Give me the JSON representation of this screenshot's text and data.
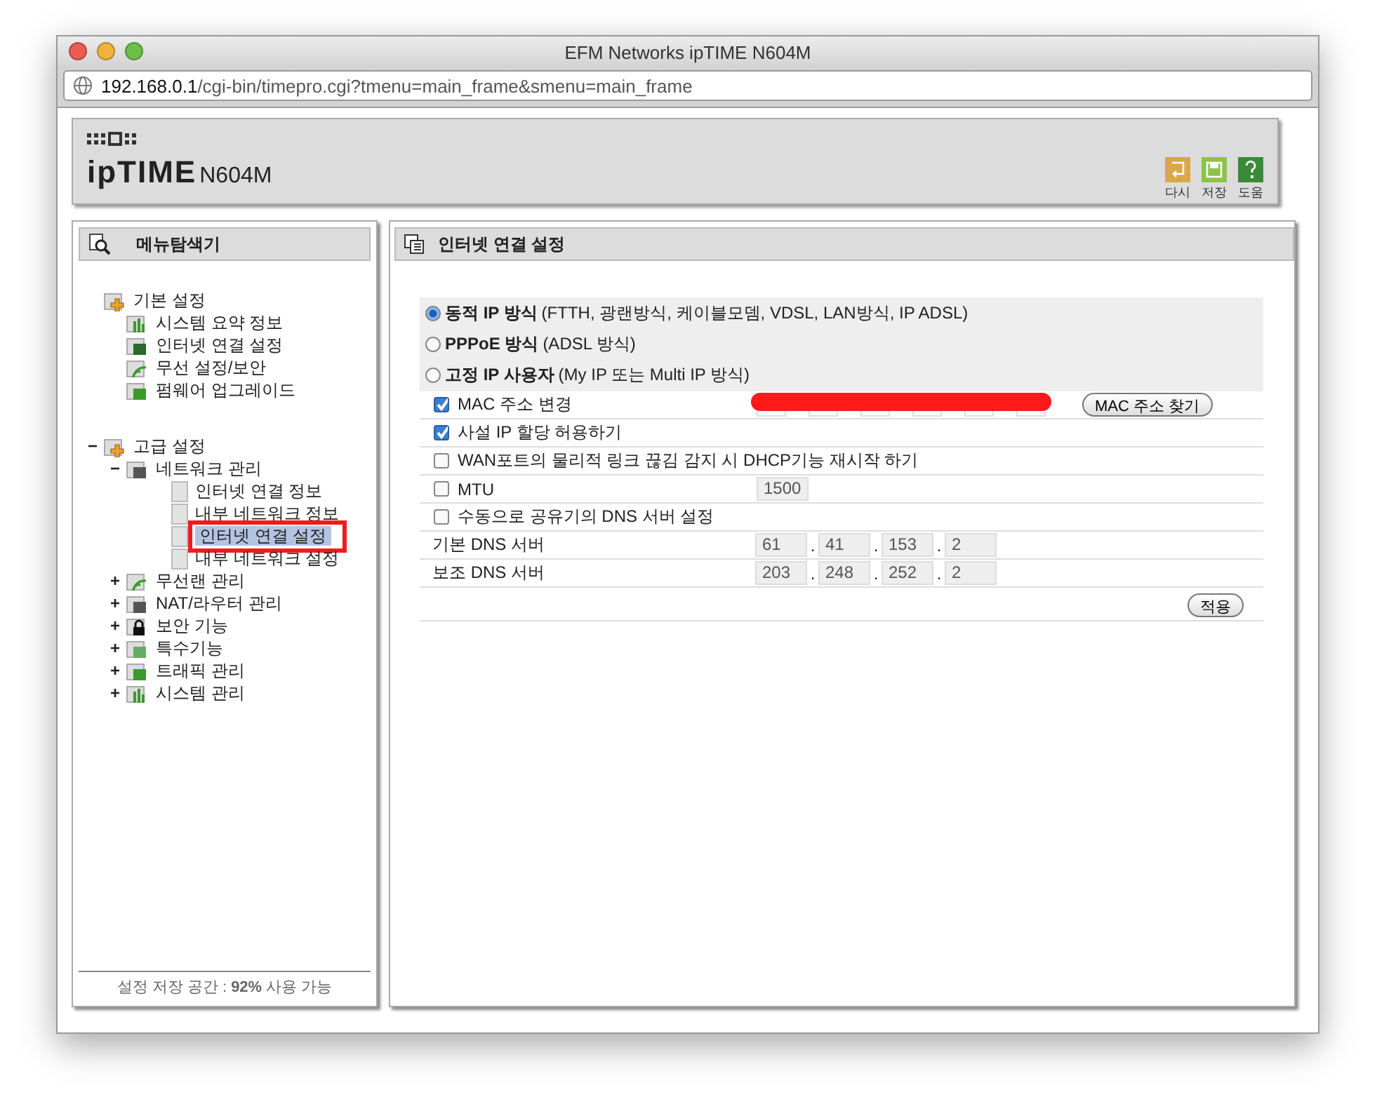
{
  "window": {
    "title": "EFM Networks ipTIME N604M"
  },
  "address_bar": {
    "host": "192.168.0.1",
    "path": "/cgi-bin/timepro.cgi?tmenu=main_frame&smenu=main_frame"
  },
  "header": {
    "logo_main": "ipTIME",
    "logo_model": "N604M",
    "actions": [
      {
        "kind": "undo",
        "label": "다시"
      },
      {
        "kind": "save",
        "label": "저장"
      },
      {
        "kind": "help",
        "label": "도움"
      }
    ]
  },
  "sidebar": {
    "title": "메뉴탐색기",
    "tree": [
      {
        "label": "기본 설정",
        "children": [
          {
            "label": "시스템 요약 정보"
          },
          {
            "label": "인터넷 연결 설정"
          },
          {
            "label": "무선 설정/보안"
          },
          {
            "label": "펌웨어 업그레이드"
          }
        ]
      },
      {
        "label": "고급 설정",
        "toggle": "−",
        "children": [
          {
            "label": "네트워크 관리",
            "toggle": "−",
            "children": [
              {
                "label": "인터넷 연결 정보",
                "selected": false
              },
              {
                "label": "내부 네트워크 정보",
                "selected": false
              },
              {
                "label": "인터넷 연결 설정",
                "selected": true
              },
              {
                "label": "내부 네트워크 설정",
                "selected": false
              }
            ]
          },
          {
            "label": "무선랜 관리",
            "toggle": "+"
          },
          {
            "label": "NAT/라우터 관리",
            "toggle": "+"
          },
          {
            "label": "보안 기능",
            "toggle": "+"
          },
          {
            "label": "특수기능",
            "toggle": "+"
          },
          {
            "label": "트래픽 관리",
            "toggle": "+"
          },
          {
            "label": "시스템 관리",
            "toggle": "+"
          }
        ]
      }
    ],
    "storage_note": "설정 저장 공간 : **92%** 사용 가능"
  },
  "content": {
    "title": "인터넷 연결 설정",
    "connection_modes": [
      {
        "name": "동적 IP 방식",
        "detail": "(FTTH, 광랜방식, 케이블모뎀, VDSL, LAN방식, IP ADSL)",
        "selected": true
      },
      {
        "name": "PPPoE 방식",
        "detail": "(ADSL 방식)",
        "selected": false
      },
      {
        "name": "고정 IP 사용자",
        "detail": "(My IP 또는 Multi IP 방식)",
        "selected": false
      }
    ],
    "rows": [
      {
        "kind": "mac",
        "label": "MAC 주소 변경",
        "checked": true,
        "redacted": true,
        "button": "MAC 주소 찾기"
      },
      {
        "kind": "check",
        "label": "사설 IP 할당 허용하기",
        "checked": true
      },
      {
        "kind": "check",
        "label": "WAN포트의 물리적 링크 끊김 감지 시 DHCP기능 재시작 하기",
        "checked": false
      },
      {
        "kind": "value",
        "label": "MTU",
        "checked": false,
        "value": "1500"
      },
      {
        "kind": "check",
        "label": "수동으로 공유기의 DNS 서버 설정",
        "checked": false
      },
      {
        "kind": "ip",
        "label": "기본 DNS 서버",
        "octets": [
          "61",
          "41",
          "153",
          "2"
        ],
        "separator": "."
      },
      {
        "kind": "ip",
        "label": "보조 DNS 서버",
        "octets": [
          "203",
          "248",
          "252",
          "2"
        ],
        "separator": "."
      }
    ],
    "apply_button": "적용"
  }
}
